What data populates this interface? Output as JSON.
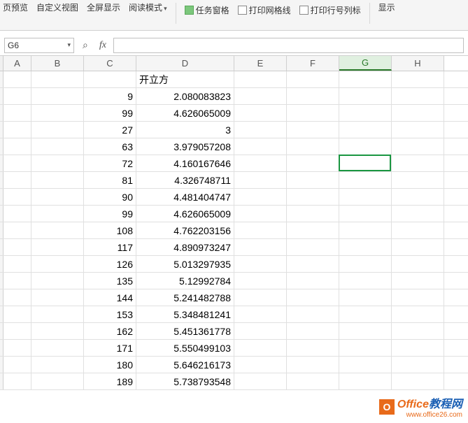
{
  "ribbon": {
    "btn_preview": "页预览",
    "btn_custom_view": "自定义视图",
    "btn_fullscreen": "全屏显示",
    "btn_reading_mode": "阅读模式",
    "chk_task_pane": "任务窗格",
    "chk_print_gridlines": "打印网格线",
    "chk_print_headings": "打印行号列标",
    "btn_show": "显示"
  },
  "formula_bar": {
    "name_box": "G6",
    "fx_label": "fx",
    "formula_value": ""
  },
  "columns": [
    "A",
    "B",
    "C",
    "D",
    "E",
    "F",
    "G",
    "H"
  ],
  "active_column": "G",
  "selection": {
    "col": "G",
    "row": 6
  },
  "sheet": {
    "header_D": "开立方",
    "rows": [
      {
        "c": 9,
        "d": "2.080083823"
      },
      {
        "c": 99,
        "d": "4.626065009"
      },
      {
        "c": 27,
        "d": "3"
      },
      {
        "c": 63,
        "d": "3.979057208"
      },
      {
        "c": 72,
        "d": "4.160167646"
      },
      {
        "c": 81,
        "d": "4.326748711"
      },
      {
        "c": 90,
        "d": "4.481404747"
      },
      {
        "c": 99,
        "d": "4.626065009"
      },
      {
        "c": 108,
        "d": "4.762203156"
      },
      {
        "c": 117,
        "d": "4.890973247"
      },
      {
        "c": 126,
        "d": "5.013297935"
      },
      {
        "c": 135,
        "d": "5.12992784"
      },
      {
        "c": 144,
        "d": "5.241482788"
      },
      {
        "c": 153,
        "d": "5.348481241"
      },
      {
        "c": 162,
        "d": "5.451361778"
      },
      {
        "c": 171,
        "d": "5.550499103"
      },
      {
        "c": 180,
        "d": "5.646216173"
      },
      {
        "c": 189,
        "d": "5.738793548"
      }
    ]
  },
  "watermark": {
    "badge": "O",
    "text_office": "Office",
    "text_suffix": "教程网",
    "url": "www.office26.com"
  },
  "colors": {
    "accent": "#1a9641",
    "wm_orange": "#e86a1a",
    "wm_blue": "#1a5fb4"
  }
}
